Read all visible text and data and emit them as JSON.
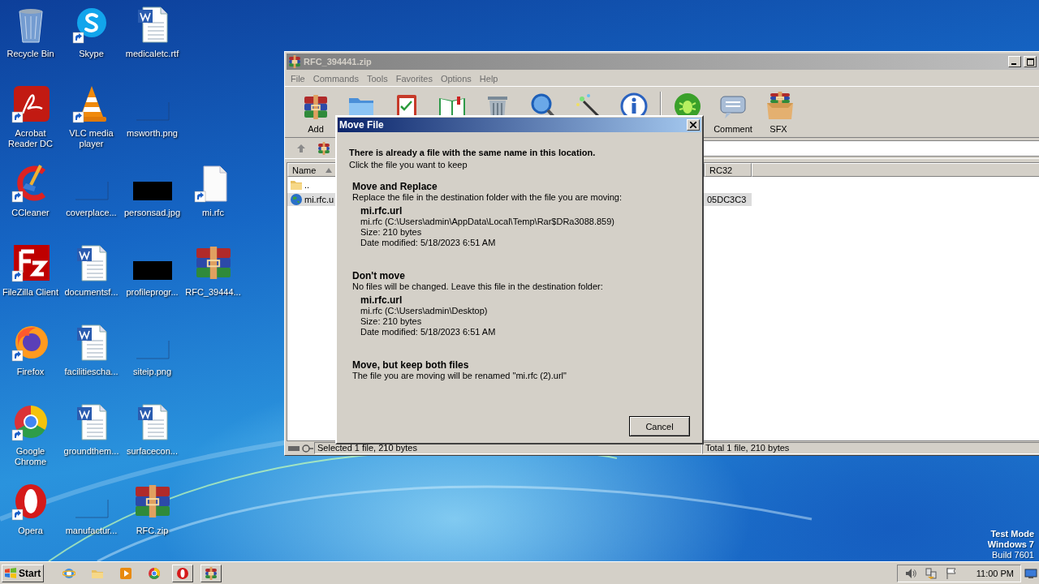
{
  "desktop": {
    "icon_rows": [
      [
        {
          "label": "Recycle Bin",
          "kind": "recycle",
          "shortcut": false
        },
        {
          "label": "Skype",
          "kind": "skype",
          "shortcut": true
        },
        {
          "label": "medicaletc.rtf",
          "kind": "word",
          "shortcut": false
        }
      ],
      [
        {
          "label": "Acrobat Reader DC",
          "kind": "acrobat",
          "shortcut": true
        },
        {
          "label": "VLC media player",
          "kind": "vlc",
          "shortcut": true
        },
        {
          "label": "msworth.png",
          "kind": "blank-image",
          "shortcut": false
        }
      ],
      [
        {
          "label": "CCleaner",
          "kind": "ccleaner",
          "shortcut": true
        },
        {
          "label": "coverplace...",
          "kind": "blank-image",
          "shortcut": false
        },
        {
          "label": "personsad.jpg",
          "kind": "black-image",
          "shortcut": false
        },
        {
          "label": "mi.rfc",
          "kind": "file",
          "shortcut": true
        }
      ],
      [
        {
          "label": "FileZilla Client",
          "kind": "filezilla",
          "shortcut": true
        },
        {
          "label": "documentsf...",
          "kind": "word",
          "shortcut": false
        },
        {
          "label": "profileprogr...",
          "kind": "black-image",
          "shortcut": false
        },
        {
          "label": "RFC_39444...",
          "kind": "winrar",
          "shortcut": false
        }
      ],
      [
        {
          "label": "Firefox",
          "kind": "firefox",
          "shortcut": true
        },
        {
          "label": "facilitiescha...",
          "kind": "word",
          "shortcut": false
        },
        {
          "label": "siteip.png",
          "kind": "blank-image",
          "shortcut": false
        }
      ],
      [
        {
          "label": "Google Chrome",
          "kind": "chrome",
          "shortcut": true
        },
        {
          "label": "groundthem...",
          "kind": "word",
          "shortcut": false
        },
        {
          "label": "surfacecon...",
          "kind": "word",
          "shortcut": false
        }
      ],
      [
        {
          "label": "Opera",
          "kind": "opera",
          "shortcut": true
        },
        {
          "label": "manufactur...",
          "kind": "blank-image",
          "shortcut": false
        },
        {
          "label": "RFC.zip",
          "kind": "winrar",
          "shortcut": false
        }
      ]
    ],
    "system_notice": [
      "Test Mode",
      "Windows 7",
      "Build 7601"
    ]
  },
  "archive_window": {
    "title": "RFC_394441.zip",
    "menu": [
      "File",
      "Commands",
      "Tools",
      "Favorites",
      "Options",
      "Help"
    ],
    "toolbar": [
      {
        "kind": "add",
        "label": "Add"
      },
      {
        "kind": "extract"
      },
      {
        "kind": "test"
      },
      {
        "kind": "view"
      },
      {
        "kind": "delete"
      },
      {
        "kind": "find"
      },
      {
        "kind": "wizard"
      },
      {
        "kind": "info"
      },
      {
        "kind": "separator"
      },
      {
        "kind": "virus"
      },
      {
        "kind": "comment",
        "label": "Comment"
      },
      {
        "kind": "sfx",
        "label": "SFX"
      }
    ],
    "column_headers": [
      "Name",
      "RC32"
    ],
    "files": [
      {
        "name": "..",
        "kind": "folder",
        "selected": false
      },
      {
        "name": "mi.rfc.u",
        "kind": "url",
        "selected": true,
        "crc": "05DC3C3"
      }
    ],
    "status": [
      "Selected 1 file, 210 bytes",
      "Total 1 file, 210 bytes"
    ]
  },
  "dialog": {
    "title": "Move File",
    "heading": "There is already a file with the same name in this location.",
    "subheading": "Click the file you want to keep",
    "options": [
      {
        "title": "Move and Replace",
        "description": "Replace the file in the destination folder with the file you are moving:",
        "file": {
          "name": "mi.rfc.url",
          "path": "mi.rfc (C:\\Users\\admin\\AppData\\Local\\Temp\\Rar$DRa3088.859)",
          "size": "Size: 210 bytes",
          "date": "Date modified: 5/18/2023 6:51 AM"
        }
      },
      {
        "title": "Don't move",
        "description": "No files will be changed. Leave this file in the destination folder:",
        "file": {
          "name": "mi.rfc.url",
          "path": "mi.rfc (C:\\Users\\admin\\Desktop)",
          "size": "Size: 210 bytes",
          "date": "Date modified: 5/18/2023 6:51 AM"
        }
      },
      {
        "title": "Move, but keep both files",
        "description": "The file you are moving will be renamed \"mi.rfc (2).url\""
      }
    ],
    "buttons": [
      "Cancel"
    ]
  },
  "taskbar": {
    "start": "Start",
    "apps": [
      {
        "kind": "ie",
        "running": false
      },
      {
        "kind": "explorer",
        "running": false
      },
      {
        "kind": "media",
        "running": false
      },
      {
        "kind": "chrome",
        "running": false
      },
      {
        "kind": "opera",
        "running": true
      },
      {
        "kind": "winrar",
        "running": true
      }
    ],
    "tray": [
      {
        "kind": "speaker"
      },
      {
        "kind": "network"
      },
      {
        "kind": "flag"
      }
    ],
    "time": "11:00 PM"
  }
}
